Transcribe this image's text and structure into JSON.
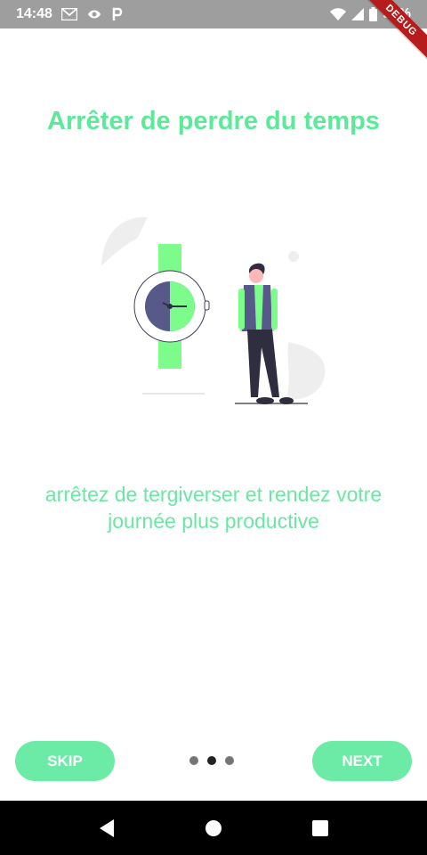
{
  "status_bar": {
    "time": "14:48",
    "battery": "99%",
    "icons_left": [
      "gmail-icon",
      "cast-icon",
      "p-icon"
    ],
    "icons_right": [
      "wifi-icon",
      "signal-icon",
      "battery-icon"
    ]
  },
  "debug_banner": "DEBUG",
  "onboarding": {
    "title": "Arrêter de perdre du temps",
    "subtitle": "arrêtez de tergiverser et rendez votre journée plus productive",
    "page_indicator": {
      "total": 3,
      "active": 1
    }
  },
  "buttons": {
    "skip": "SKIP",
    "next": "NEXT"
  },
  "nav_bar": {
    "icons": [
      "back-icon",
      "home-icon",
      "recents-icon"
    ]
  },
  "colors": {
    "accent": "#6beba6",
    "title": "#5ee89a",
    "status_bar": "#9e9e9e",
    "illustration_green": "#7cfc8a",
    "illustration_navy": "#575a89"
  }
}
